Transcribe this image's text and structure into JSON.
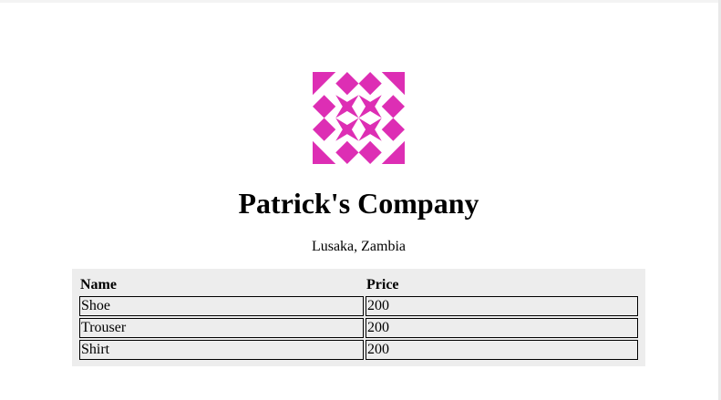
{
  "company": {
    "name": "Patrick's Company",
    "location": "Lusaka, Zambia",
    "logo": {
      "icon": "geometric-avatar-icon",
      "color": "#dd2eb4"
    }
  },
  "table": {
    "headers": [
      "Name",
      "Price"
    ],
    "rows": [
      [
        "Shoe",
        "200"
      ],
      [
        "Trouser",
        "200"
      ],
      [
        "Shirt",
        "200"
      ]
    ]
  }
}
